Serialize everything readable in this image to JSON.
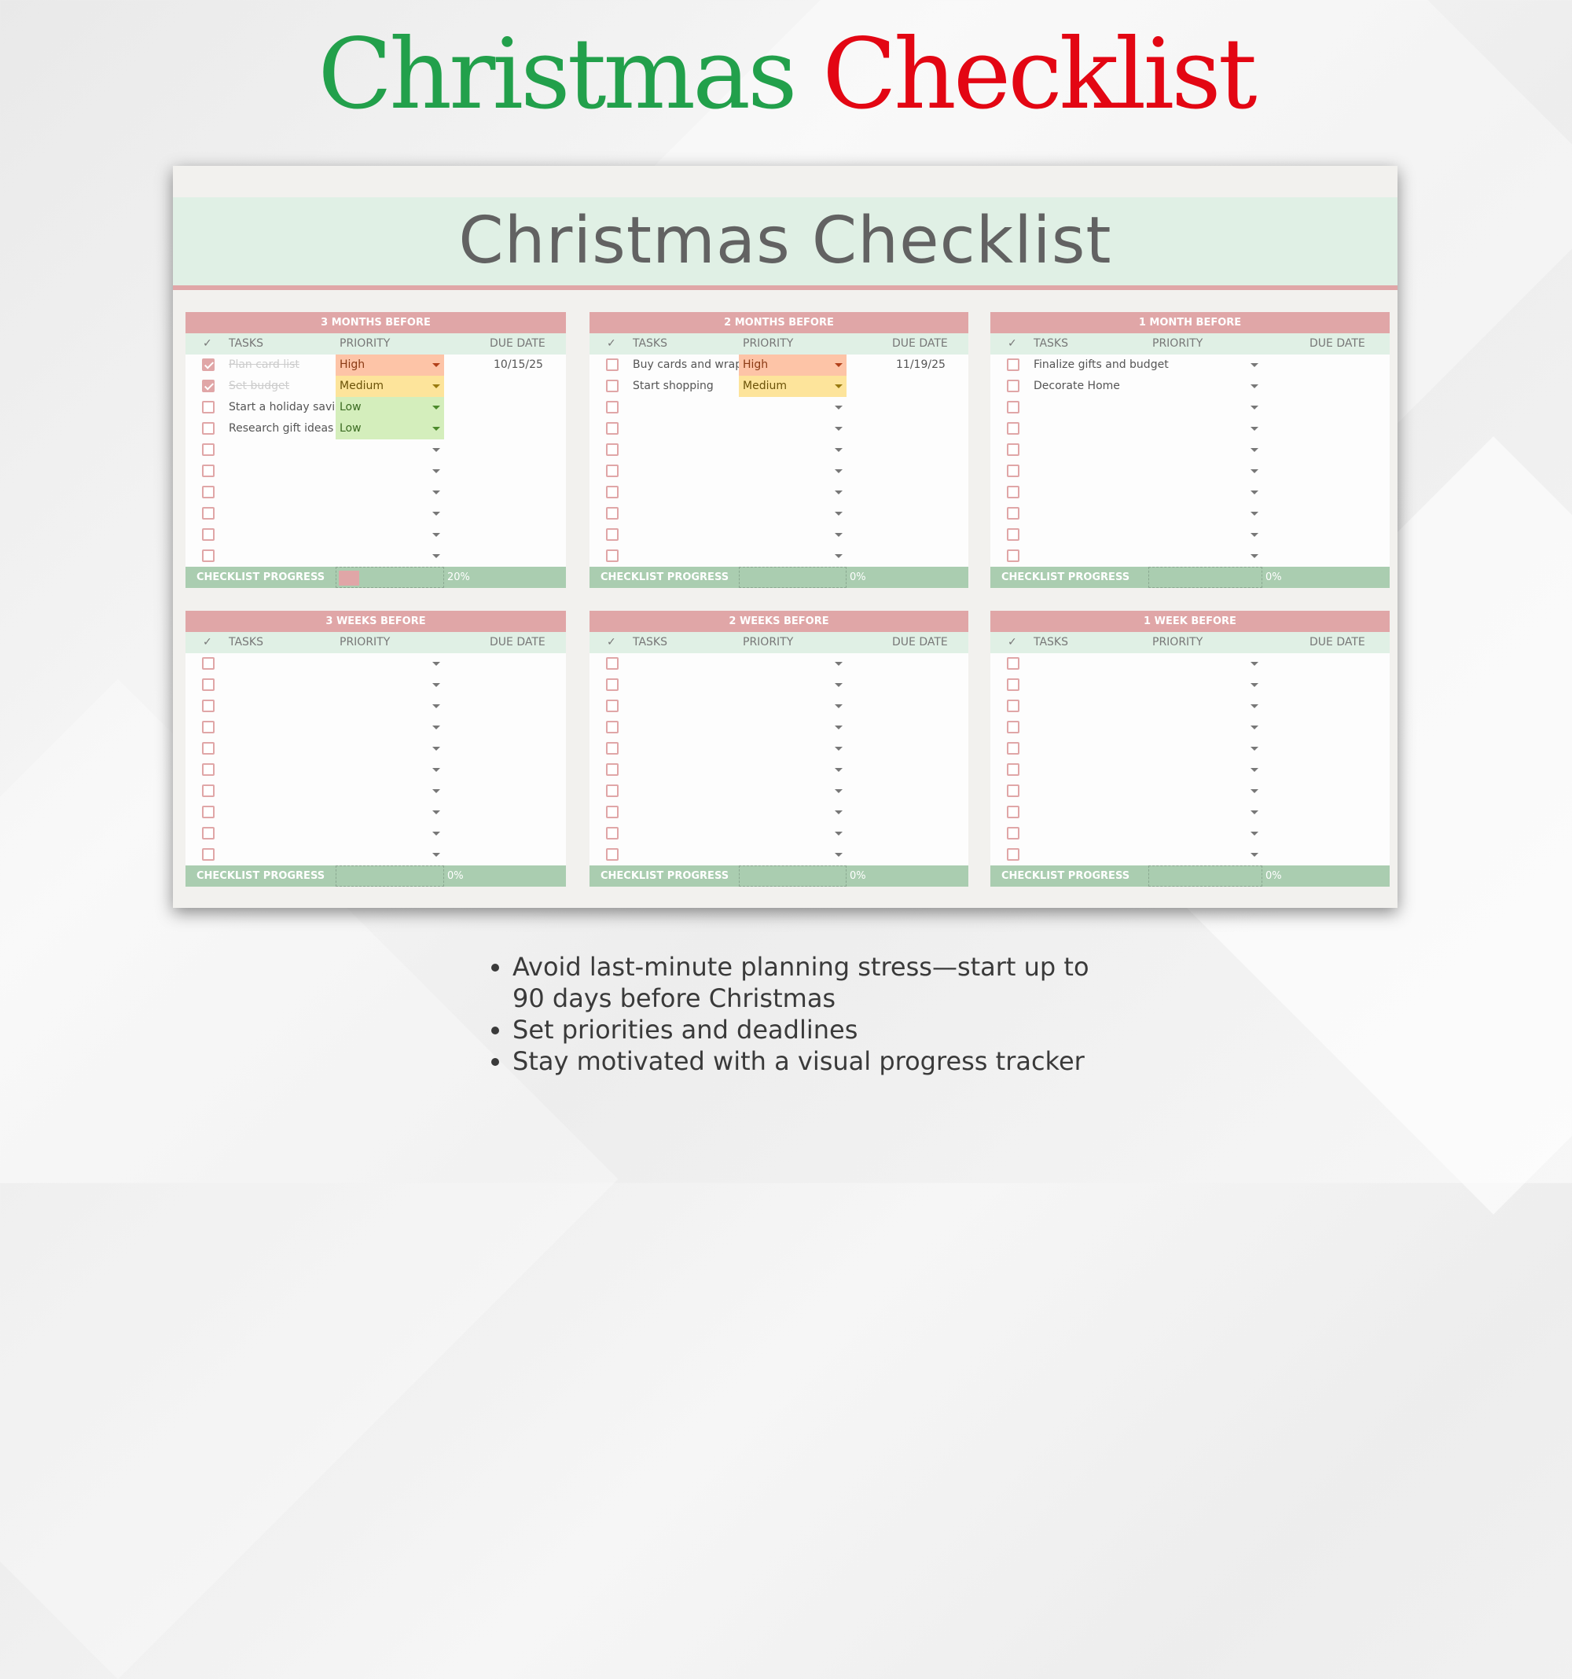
{
  "headline": {
    "word1": "Christmas",
    "word2": "Checklist"
  },
  "banner_title": "Christmas Checklist",
  "columns": {
    "check": "✓",
    "tasks": "TASKS",
    "priority": "PRIORITY",
    "due": "DUE DATE"
  },
  "progress_label": "CHECKLIST PROGRESS",
  "sections": [
    {
      "title": "3 MONTHS BEFORE",
      "progress_pct": 20,
      "progress_text": "20%",
      "rows": [
        {
          "checked": true,
          "task": "Plan card list",
          "priority": "High",
          "due": "10/15/25"
        },
        {
          "checked": true,
          "task": "Set budget",
          "priority": "Medium",
          "due": ""
        },
        {
          "checked": false,
          "task": "Start a holiday savings f",
          "priority": "Low",
          "due": ""
        },
        {
          "checked": false,
          "task": "Research gift ideas",
          "priority": "Low",
          "due": ""
        },
        {
          "checked": false,
          "task": "",
          "priority": "",
          "due": ""
        },
        {
          "checked": false,
          "task": "",
          "priority": "",
          "due": ""
        },
        {
          "checked": false,
          "task": "",
          "priority": "",
          "due": ""
        },
        {
          "checked": false,
          "task": "",
          "priority": "",
          "due": ""
        },
        {
          "checked": false,
          "task": "",
          "priority": "",
          "due": ""
        },
        {
          "checked": false,
          "task": "",
          "priority": "",
          "due": ""
        }
      ]
    },
    {
      "title": "2 MONTHS BEFORE",
      "progress_pct": 0,
      "progress_text": "0%",
      "rows": [
        {
          "checked": false,
          "task": "Buy cards and wrap",
          "priority": "High",
          "due": "11/19/25"
        },
        {
          "checked": false,
          "task": "Start shopping",
          "priority": "Medium",
          "due": ""
        },
        {
          "checked": false,
          "task": "",
          "priority": "",
          "due": ""
        },
        {
          "checked": false,
          "task": "",
          "priority": "",
          "due": ""
        },
        {
          "checked": false,
          "task": "",
          "priority": "",
          "due": ""
        },
        {
          "checked": false,
          "task": "",
          "priority": "",
          "due": ""
        },
        {
          "checked": false,
          "task": "",
          "priority": "",
          "due": ""
        },
        {
          "checked": false,
          "task": "",
          "priority": "",
          "due": ""
        },
        {
          "checked": false,
          "task": "",
          "priority": "",
          "due": ""
        },
        {
          "checked": false,
          "task": "",
          "priority": "",
          "due": ""
        }
      ]
    },
    {
      "title": "1 MONTH BEFORE",
      "progress_pct": 0,
      "progress_text": "0%",
      "rows": [
        {
          "checked": false,
          "task": "Finalize gifts and budget",
          "priority": "",
          "due": ""
        },
        {
          "checked": false,
          "task": "Decorate Home",
          "priority": "",
          "due": ""
        },
        {
          "checked": false,
          "task": "",
          "priority": "",
          "due": ""
        },
        {
          "checked": false,
          "task": "",
          "priority": "",
          "due": ""
        },
        {
          "checked": false,
          "task": "",
          "priority": "",
          "due": ""
        },
        {
          "checked": false,
          "task": "",
          "priority": "",
          "due": ""
        },
        {
          "checked": false,
          "task": "",
          "priority": "",
          "due": ""
        },
        {
          "checked": false,
          "task": "",
          "priority": "",
          "due": ""
        },
        {
          "checked": false,
          "task": "",
          "priority": "",
          "due": ""
        },
        {
          "checked": false,
          "task": "",
          "priority": "",
          "due": ""
        }
      ]
    },
    {
      "title": "3 WEEKS BEFORE",
      "progress_pct": 0,
      "progress_text": "0%",
      "rows": [
        {
          "checked": false,
          "task": "",
          "priority": "",
          "due": ""
        },
        {
          "checked": false,
          "task": "",
          "priority": "",
          "due": ""
        },
        {
          "checked": false,
          "task": "",
          "priority": "",
          "due": ""
        },
        {
          "checked": false,
          "task": "",
          "priority": "",
          "due": ""
        },
        {
          "checked": false,
          "task": "",
          "priority": "",
          "due": ""
        },
        {
          "checked": false,
          "task": "",
          "priority": "",
          "due": ""
        },
        {
          "checked": false,
          "task": "",
          "priority": "",
          "due": ""
        },
        {
          "checked": false,
          "task": "",
          "priority": "",
          "due": ""
        },
        {
          "checked": false,
          "task": "",
          "priority": "",
          "due": ""
        },
        {
          "checked": false,
          "task": "",
          "priority": "",
          "due": ""
        }
      ]
    },
    {
      "title": "2 WEEKS BEFORE",
      "progress_pct": 0,
      "progress_text": "0%",
      "rows": [
        {
          "checked": false,
          "task": "",
          "priority": "",
          "due": ""
        },
        {
          "checked": false,
          "task": "",
          "priority": "",
          "due": ""
        },
        {
          "checked": false,
          "task": "",
          "priority": "",
          "due": ""
        },
        {
          "checked": false,
          "task": "",
          "priority": "",
          "due": ""
        },
        {
          "checked": false,
          "task": "",
          "priority": "",
          "due": ""
        },
        {
          "checked": false,
          "task": "",
          "priority": "",
          "due": ""
        },
        {
          "checked": false,
          "task": "",
          "priority": "",
          "due": ""
        },
        {
          "checked": false,
          "task": "",
          "priority": "",
          "due": ""
        },
        {
          "checked": false,
          "task": "",
          "priority": "",
          "due": ""
        },
        {
          "checked": false,
          "task": "",
          "priority": "",
          "due": ""
        }
      ]
    },
    {
      "title": "1 WEEK BEFORE",
      "progress_pct": 0,
      "progress_text": "0%",
      "rows": [
        {
          "checked": false,
          "task": "",
          "priority": "",
          "due": ""
        },
        {
          "checked": false,
          "task": "",
          "priority": "",
          "due": ""
        },
        {
          "checked": false,
          "task": "",
          "priority": "",
          "due": ""
        },
        {
          "checked": false,
          "task": "",
          "priority": "",
          "due": ""
        },
        {
          "checked": false,
          "task": "",
          "priority": "",
          "due": ""
        },
        {
          "checked": false,
          "task": "",
          "priority": "",
          "due": ""
        },
        {
          "checked": false,
          "task": "",
          "priority": "",
          "due": ""
        },
        {
          "checked": false,
          "task": "",
          "priority": "",
          "due": ""
        },
        {
          "checked": false,
          "task": "",
          "priority": "",
          "due": ""
        },
        {
          "checked": false,
          "task": "",
          "priority": "",
          "due": ""
        }
      ]
    }
  ],
  "bullets": [
    "Avoid last-minute planning stress—start up to 90 days before Christmas",
    "Set priorities and deadlines",
    "Stay motivated with a visual progress tracker"
  ],
  "colors": {
    "green_title": "#22a04b",
    "red_title": "#e30613",
    "section_header": "#e0a6a7",
    "column_header": "#e0f0e5",
    "progress_row": "#aacdb0"
  }
}
